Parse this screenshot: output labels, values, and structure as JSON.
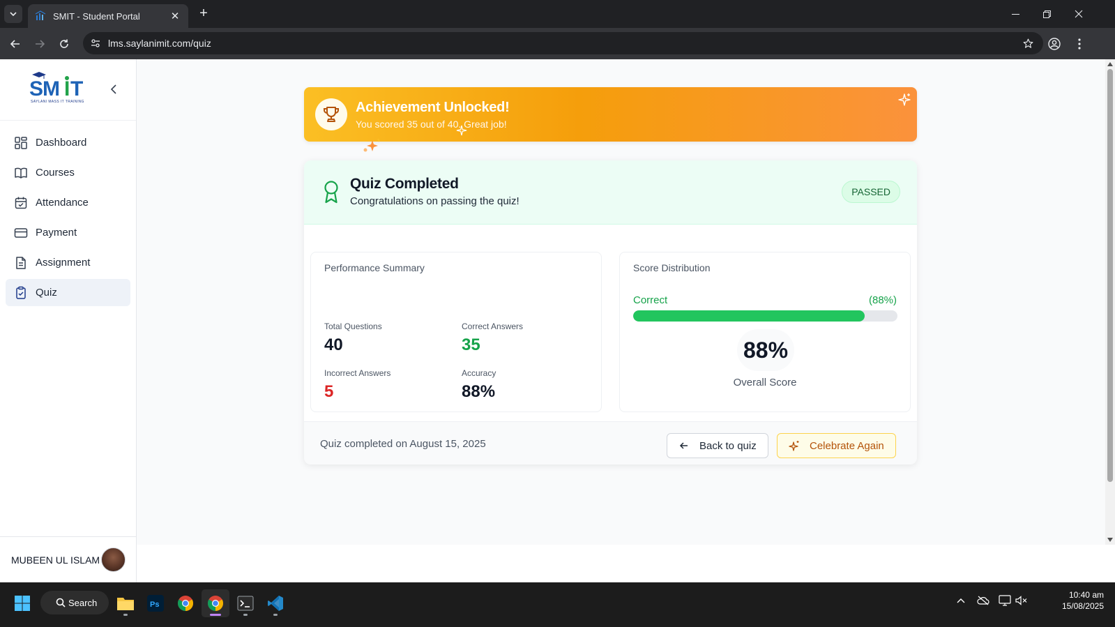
{
  "browser": {
    "tab_title": "SMIT - Student Portal",
    "url": "lms.saylanimit.com/quiz"
  },
  "sidebar": {
    "logo_text": "SMIT",
    "logo_tagline": "SAYLANI MASS IT TRAINING",
    "items": [
      {
        "label": "Dashboard",
        "icon": "dashboard-icon"
      },
      {
        "label": "Courses",
        "icon": "book-icon"
      },
      {
        "label": "Attendance",
        "icon": "calendar-check-icon"
      },
      {
        "label": "Payment",
        "icon": "credit-card-icon"
      },
      {
        "label": "Assignment",
        "icon": "file-text-icon"
      },
      {
        "label": "Quiz",
        "icon": "clipboard-check-icon",
        "active": true
      }
    ],
    "user_name": "MUBEEN UL ISLAM"
  },
  "banner": {
    "title": "Achievement Unlocked!",
    "subtitle": "You scored 35 out of 40. Great job!"
  },
  "result": {
    "title": "Quiz Completed",
    "subtitle": "Congratulations on passing the quiz!",
    "status": "PASSED",
    "performance": {
      "title": "Performance Summary",
      "total_label": "Total Questions",
      "total_value": "40",
      "correct_label": "Correct Answers",
      "correct_value": "35",
      "incorrect_label": "Incorrect Answers",
      "incorrect_value": "5",
      "accuracy_label": "Accuracy",
      "accuracy_value": "88%"
    },
    "distribution": {
      "title": "Score Distribution",
      "correct_label": "Correct",
      "correct_pct_text": "(88%)",
      "correct_fraction": 0.875,
      "score": "88%",
      "score_label": "Overall Score"
    },
    "footer": {
      "completed_text": "Quiz completed on August 15, 2025",
      "back_label": "Back to quiz",
      "celebrate_label": "Celebrate Again"
    }
  },
  "taskbar": {
    "search_label": "Search",
    "time": "10:40 am",
    "date": "15/08/2025"
  },
  "colors": {
    "accent_green": "#16a34a",
    "accent_red": "#dc2626",
    "banner_orange": "#f59e0b",
    "brand_blue": "#1e63b6"
  }
}
